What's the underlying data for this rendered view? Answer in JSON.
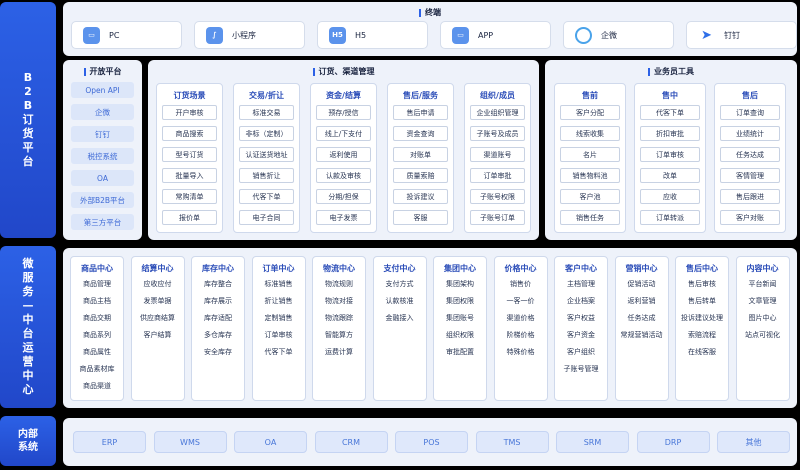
{
  "bands": {
    "b2b": [
      "B",
      "2",
      "B",
      "订",
      "货",
      "平",
      "台"
    ],
    "micro": [
      "微",
      "服",
      "务",
      "—",
      "中",
      "台",
      "运",
      "营",
      "中",
      "心"
    ],
    "internal": [
      "内部",
      "系统"
    ]
  },
  "terminal": {
    "title": "终端",
    "items": [
      {
        "label": "PC",
        "icon": "monitor-icon",
        "glyph": "▭"
      },
      {
        "label": "小程序",
        "icon": "mini-program-icon",
        "glyph": "∫"
      },
      {
        "label": "H5",
        "icon": "h5-icon",
        "glyph": "H5"
      },
      {
        "label": "APP",
        "icon": "app-icon",
        "glyph": "▭"
      },
      {
        "label": "企微",
        "icon": "wecom-icon",
        "glyph": ""
      },
      {
        "label": "钉钉",
        "icon": "dingtalk-icon",
        "glyph": "➤"
      }
    ]
  },
  "open_platform": {
    "title": "开放平台",
    "items": [
      "Open API",
      "企微",
      "钉钉",
      "税控系统",
      "OA",
      "外部B2B平台",
      "第三方平台"
    ]
  },
  "order_channel": {
    "title": "订货、渠道管理",
    "columns": [
      {
        "title": "订货场景",
        "items": [
          "开户审核",
          "商品搜索",
          "型号订货",
          "批量导入",
          "常购清单",
          "报价单"
        ]
      },
      {
        "title": "交易/折让",
        "items": [
          "标准交易",
          "非标（定制）",
          "认证送货地址",
          "销售折让",
          "代客下单",
          "电子合同"
        ]
      },
      {
        "title": "资金/结算",
        "items": [
          "预存/授信",
          "线上/下支付",
          "返利使用",
          "认款及审核",
          "分期/担保",
          "电子发票"
        ]
      },
      {
        "title": "售后/服务",
        "items": [
          "售后申请",
          "资金查询",
          "对账单",
          "质量索赔",
          "投诉建议",
          "客服"
        ]
      },
      {
        "title": "组织/成员",
        "items": [
          "企业组织管理",
          "子账号及成员",
          "渠道账号",
          "订单审批",
          "子账号权限",
          "子账号订单"
        ]
      }
    ]
  },
  "sales_tools": {
    "title": "业务员工具",
    "columns": [
      {
        "title": "售前",
        "items": [
          "客户分配",
          "线索收集",
          "名片",
          "销售物料池",
          "客户池",
          "销售任务"
        ]
      },
      {
        "title": "售中",
        "items": [
          "代客下单",
          "折扣审批",
          "订单审核",
          "改单",
          "应收",
          "订单转派"
        ]
      },
      {
        "title": "售后",
        "items": [
          "订单查询",
          "业绩统计",
          "任务达成",
          "客情管理",
          "售后跟进",
          "客户对账"
        ]
      }
    ]
  },
  "micro_services": {
    "columns": [
      {
        "title": "商品中心",
        "items": [
          "商品管理",
          "商品主档",
          "商品交期",
          "商品系列",
          "商品属性",
          "商品素材库",
          "商品渠道"
        ]
      },
      {
        "title": "结算中心",
        "items": [
          "应收应付",
          "发票单据",
          "供应商结算",
          "客户结算"
        ]
      },
      {
        "title": "库存中心",
        "items": [
          "库存整合",
          "库存展示",
          "库存适配",
          "多仓库存",
          "安全库存"
        ]
      },
      {
        "title": "订单中心",
        "items": [
          "标准销售",
          "折让销售",
          "定制销售",
          "订单审核",
          "代客下单"
        ]
      },
      {
        "title": "物流中心",
        "items": [
          "物流规则",
          "物流对接",
          "物流跟踪",
          "智能算方",
          "运费计算"
        ]
      },
      {
        "title": "支付中心",
        "items": [
          "支付方式",
          "认款核准",
          "金融接入"
        ]
      },
      {
        "title": "集团中心",
        "items": [
          "集团架构",
          "集团权限",
          "集团账号",
          "组织权限",
          "审批配置"
        ]
      },
      {
        "title": "价格中心",
        "items": [
          "销售价",
          "一客一价",
          "渠道价格",
          "阶梯价格",
          "特殊价格"
        ]
      },
      {
        "title": "客户中心",
        "items": [
          "主档管理",
          "企业档案",
          "客户权益",
          "客户资金",
          "客户组织",
          "子账号管理"
        ]
      },
      {
        "title": "营销中心",
        "items": [
          "促销活动",
          "返利营销",
          "任务达成",
          "常规营销活动"
        ]
      },
      {
        "title": "售后中心",
        "items": [
          "售后审核",
          "售后转单",
          "投诉建议处理",
          "索赔流程",
          "在线客服"
        ]
      },
      {
        "title": "内容中心",
        "items": [
          "平台新闻",
          "文章管理",
          "图片中心",
          "站点可视化"
        ]
      }
    ]
  },
  "internal_systems": [
    "ERP",
    "WMS",
    "OA",
    "CRM",
    "POS",
    "TMS",
    "SRM",
    "DRP",
    "其他"
  ]
}
